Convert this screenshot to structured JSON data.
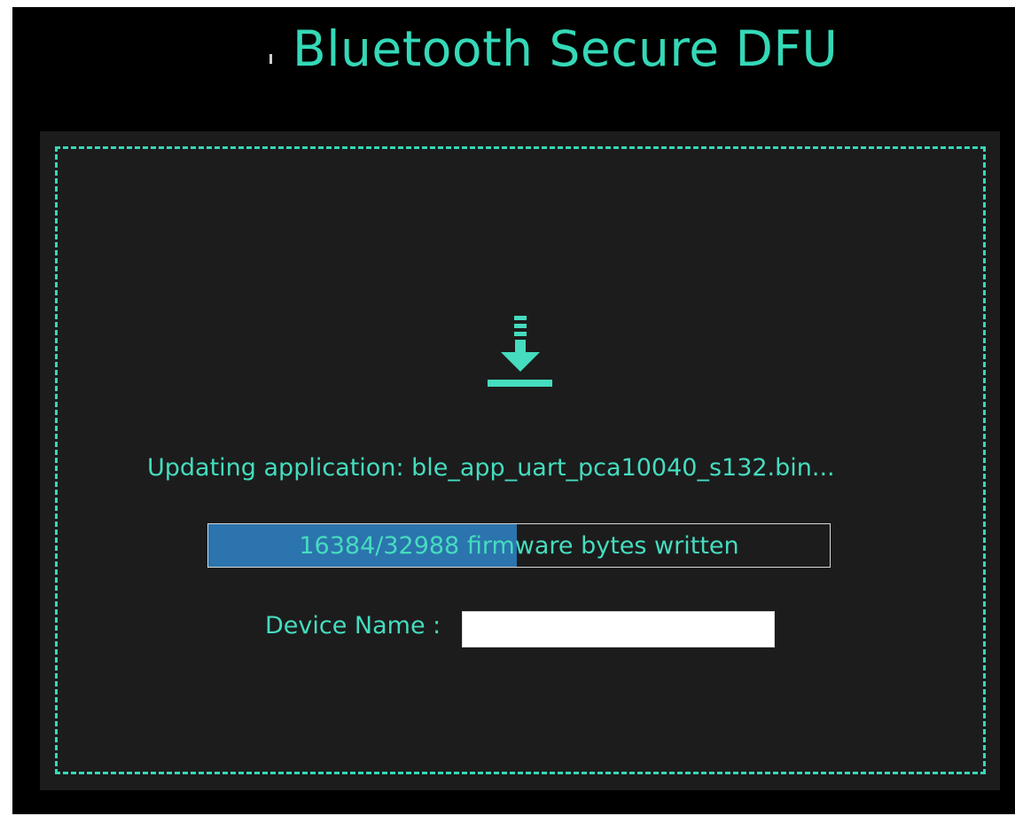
{
  "header": {
    "title": "Bluetooth Secure DFU"
  },
  "status": {
    "message": "Updating application: ble_app_uart_pca10040_s132.bin..."
  },
  "progress": {
    "text": "16384/32988 firmware bytes written",
    "written": 16384,
    "total": 32988
  },
  "device": {
    "label": "Device Name :",
    "value": ""
  },
  "icons": {
    "update": "download-icon"
  },
  "colors": {
    "accent": "#34d8b7",
    "progress_fill": "#2b74ad",
    "panel": "#1c1c1c",
    "background": "#000000"
  }
}
